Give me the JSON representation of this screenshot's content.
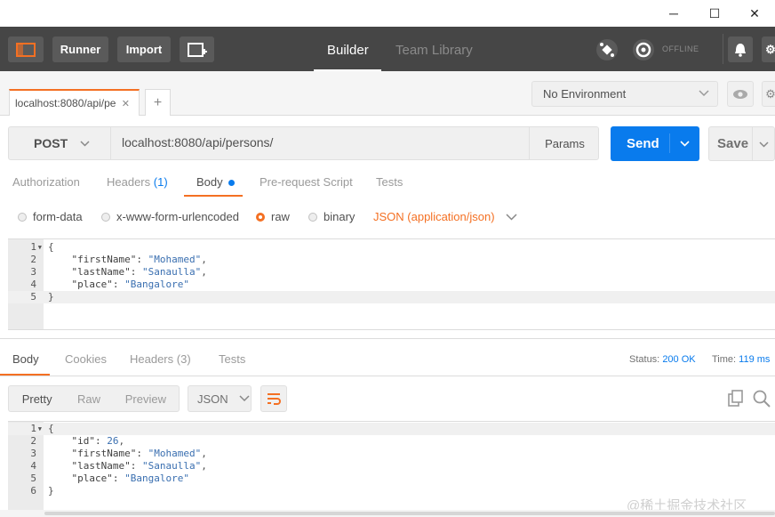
{
  "window": {
    "minimize": "─",
    "maximize": "☐",
    "close": "✕"
  },
  "toolbar": {
    "runner": "Runner",
    "import": "Import",
    "tab_builder": "Builder",
    "tab_team_library": "Team Library",
    "offline": "OFFLINE"
  },
  "request_tabs": [
    {
      "label": "localhost:8080/api/pe",
      "close": "✕"
    }
  ],
  "new_tab": "+",
  "environment": {
    "selected": "No Environment"
  },
  "request": {
    "method": "POST",
    "url": "localhost:8080/api/persons/",
    "params": "Params",
    "send": "Send",
    "save": "Save"
  },
  "request_subtabs": {
    "authorization": "Authorization",
    "headers": "Headers",
    "headers_count": "(1)",
    "body": "Body",
    "pre_request": "Pre-request Script",
    "tests": "Tests"
  },
  "body_modes": {
    "form_data": "form-data",
    "urlencoded": "x-www-form-urlencoded",
    "raw": "raw",
    "binary": "binary",
    "content_type": "JSON (application/json)"
  },
  "request_body": [
    {
      "n": "1",
      "text": "{"
    },
    {
      "n": "2",
      "key": "    \"firstName\": ",
      "val": "\"Mohamed\"",
      "tail": ","
    },
    {
      "n": "3",
      "key": "    \"lastName\": ",
      "val": "\"Sanaulla\"",
      "tail": ","
    },
    {
      "n": "4",
      "key": "    \"place\": ",
      "val": "\"Bangalore\"",
      "tail": ""
    },
    {
      "n": "5",
      "text": "}"
    }
  ],
  "response_tabs": {
    "body": "Body",
    "cookies": "Cookies",
    "headers": "Headers",
    "headers_count": "(3)",
    "tests": "Tests"
  },
  "response_status": {
    "status_label": "Status:",
    "status": "200 OK",
    "time_label": "Time:",
    "time": "119 ms"
  },
  "response_view": {
    "pretty": "Pretty",
    "raw": "Raw",
    "preview": "Preview",
    "format": "JSON"
  },
  "response_body": [
    {
      "n": "1",
      "text": "{"
    },
    {
      "n": "2",
      "key": "    \"id\": ",
      "val": "26",
      "tail": ","
    },
    {
      "n": "3",
      "key": "    \"firstName\": ",
      "val": "\"Mohamed\"",
      "tail": ","
    },
    {
      "n": "4",
      "key": "    \"lastName\": ",
      "val": "\"Sanaulla\"",
      "tail": ","
    },
    {
      "n": "5",
      "key": "    \"place\": ",
      "val": "\"Bangalore\"",
      "tail": ""
    },
    {
      "n": "6",
      "text": "}"
    }
  ],
  "watermark": "@稀土掘金技术社区",
  "colors": {
    "accent": "#f47023",
    "send": "#097bed",
    "topbar": "#464646"
  }
}
